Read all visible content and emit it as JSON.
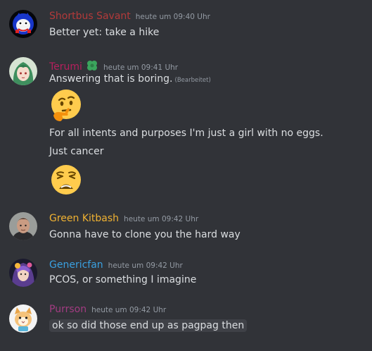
{
  "colors": {
    "background": "#313338",
    "text": "#dbdee1",
    "muted": "#949ba4"
  },
  "messages": [
    {
      "username": "Shortbus Savant",
      "name_color": "#b33a3a",
      "timestamp": "heute um 09:40 Uhr",
      "lines": [
        "Better yet: take a hike"
      ]
    },
    {
      "username": "Terumi",
      "name_color": "#b6205d",
      "timestamp": "heute um 09:41 Uhr",
      "badge_icon": "green-clover-icon",
      "lines": [
        "Answering that is boring.",
        "For all intents and purposes I'm just a girl with no eggs.",
        "Just cancer"
      ],
      "edited_label": "(Bearbeitet)",
      "emojis": [
        "thinking-face-emoji",
        "weary-face-emoji"
      ]
    },
    {
      "username": "Green Kitbash",
      "name_color": "#f0b232",
      "timestamp": "heute um 09:42 Uhr",
      "lines": [
        "Gonna have to clone you the hard way"
      ]
    },
    {
      "username": "Genericfan",
      "name_color": "#3aa0e0",
      "timestamp": "heute um 09:42 Uhr",
      "lines": [
        "PCOS, or something I imagine"
      ]
    },
    {
      "username": "Purrson",
      "name_color": "#a23c82",
      "timestamp": "heute um 09:42 Uhr",
      "lines": [
        "ok so did those end up as pagpag then"
      ]
    }
  ]
}
